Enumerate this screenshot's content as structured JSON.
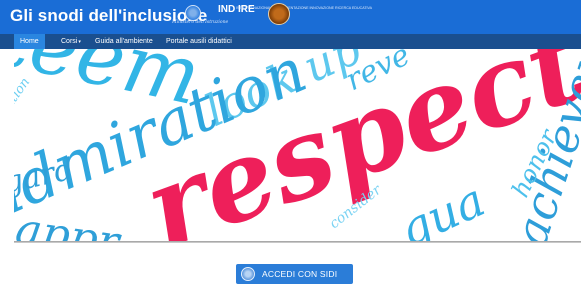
{
  "header": {
    "site_title": "Gli snodi dell'inclusione",
    "ministry_signature": "Ministero dell'Istruzione",
    "indire_logo": "IND IRE",
    "indire_small": "ISTITUTO NAZIONALE DOCUMENTAZIONE INNOVAZIONE RICERCA EDUCATIVA",
    "brand_color": "#1a6dd6"
  },
  "nav": {
    "items": [
      {
        "label": "Home",
        "active": true
      },
      {
        "label": "Corsi",
        "has_dropdown": true
      },
      {
        "label": "Guida all'ambiente"
      },
      {
        "label": "Portale ausili didattici"
      }
    ]
  },
  "banner": {
    "words": [
      "steem",
      "look up",
      "reve",
      "admiration",
      "peration",
      "gard",
      "respect",
      "achievem",
      "honor",
      "consider",
      "appr",
      "gua"
    ]
  },
  "login": {
    "button_label": "ACCEDI CON SIDI",
    "icon": "ministry-emblem-icon"
  }
}
